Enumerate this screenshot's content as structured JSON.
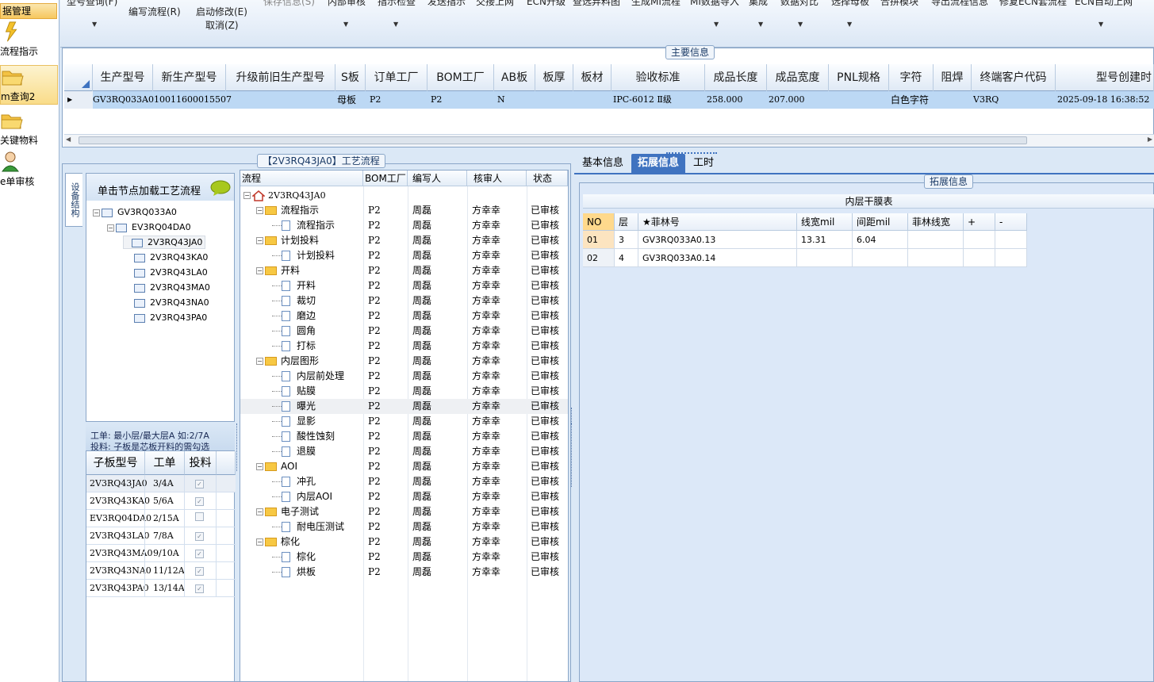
{
  "left_nav": {
    "header": "据管理",
    "items": [
      {
        "label": "流程指示",
        "icon": "lightning-icon"
      },
      {
        "label": "m查询2",
        "icon": "folder-open-icon"
      },
      {
        "label": "关键物料",
        "icon": "folder-open-icon"
      },
      {
        "label": "e单审核",
        "icon": "user-icon"
      }
    ]
  },
  "toolbar": {
    "row1": [
      "型号查询(F)",
      "保存信息(S)",
      "内部审核",
      "指示检查",
      "发送指示",
      "交接上网",
      "ECN升级",
      "查选弃料图",
      "生成MI流程",
      "MI数据导入",
      "集成",
      "数据对比",
      "选择母板",
      "合拼模块",
      "导出流程信息",
      "修复ECN套流程",
      "ECN自动上网"
    ],
    "edit_flow": "编写流程(R)",
    "start_modify": "启动修改(E)",
    "cancel": "取消(Z)"
  },
  "main_info": {
    "title": "主要信息",
    "columns": [
      "生产型号",
      "新生产型号",
      "升级前旧生产型号",
      "S板",
      "订单工厂",
      "BOM工厂",
      "AB板",
      "板厚",
      "板材",
      "验收标准",
      "成品长度",
      "成品宽度",
      "PNL规格",
      "字符",
      "阻焊",
      "终端客户代码",
      "型号创建时"
    ],
    "row": {
      "prod_model": "GV3RQ033A0",
      "new_model": "10011600015507",
      "old_model": "",
      "s_board": "母板",
      "order_factory": "P2",
      "bom_factory": "P2",
      "ab_board": "N",
      "thickness": "",
      "material": "",
      "standard": "IPC-6012 Ⅱ级",
      "length": "258.000",
      "width": "207.000",
      "pnl": "",
      "char": "白色字符",
      "solder": "",
      "customer_code": "V3RQ",
      "created": "2025-09-18 16:38:52"
    }
  },
  "flow_panel_title": "【2V3RQ43JA0】工艺流程",
  "side_tab": "设备结构",
  "tree": {
    "hint": "单击节点加载工艺流程",
    "nodes": [
      "GV3RQ033A0",
      "EV3RQ04DA0",
      "2V3RQ43JA0",
      "2V3RQ43KA0",
      "2V3RQ43LA0",
      "2V3RQ43MA0",
      "2V3RQ43NA0",
      "2V3RQ43PA0"
    ]
  },
  "note": {
    "line1": "工单: 最小层/最大层A 如:2/7A",
    "line2": "投料: 子板是芯板开料的需勾选"
  },
  "sub_grid": {
    "columns": [
      "子板型号",
      "工单",
      "投料"
    ],
    "rows": [
      {
        "model": "2V3RQ43JA0",
        "wo": "3/4A",
        "checked": true
      },
      {
        "model": "2V3RQ43KA0",
        "wo": "5/6A",
        "checked": true
      },
      {
        "model": "EV3RQ04DA0",
        "wo": "2/15A",
        "checked": false
      },
      {
        "model": "2V3RQ43LA0",
        "wo": "7/8A",
        "checked": true
      },
      {
        "model": "2V3RQ43MA0",
        "wo": "9/10A",
        "checked": true
      },
      {
        "model": "2V3RQ43NA0",
        "wo": "11/12A",
        "checked": true
      },
      {
        "model": "2V3RQ43PA0",
        "wo": "13/14A",
        "checked": true
      }
    ]
  },
  "flow": {
    "columns": [
      "流程",
      "BOM工厂",
      "编写人",
      "核审人",
      "状态"
    ],
    "root": "2V3RQ43JA0",
    "rows": [
      {
        "level": 1,
        "name": "流程指示",
        "bom": "P2",
        "writer": "周磊",
        "reviewer": "方幸幸",
        "status": "已审核"
      },
      {
        "level": 2,
        "name": "流程指示",
        "bom": "P2",
        "writer": "周磊",
        "reviewer": "方幸幸",
        "status": "已审核"
      },
      {
        "level": 1,
        "name": "计划投料",
        "bom": "P2",
        "writer": "周磊",
        "reviewer": "方幸幸",
        "status": "已审核"
      },
      {
        "level": 2,
        "name": "计划投料",
        "bom": "P2",
        "writer": "周磊",
        "reviewer": "方幸幸",
        "status": "已审核"
      },
      {
        "level": 1,
        "name": "开料",
        "bom": "P2",
        "writer": "周磊",
        "reviewer": "方幸幸",
        "status": "已审核"
      },
      {
        "level": 2,
        "name": "开料",
        "bom": "P2",
        "writer": "周磊",
        "reviewer": "方幸幸",
        "status": "已审核"
      },
      {
        "level": 2,
        "name": "裁切",
        "bom": "P2",
        "writer": "周磊",
        "reviewer": "方幸幸",
        "status": "已审核"
      },
      {
        "level": 2,
        "name": "磨边",
        "bom": "P2",
        "writer": "周磊",
        "reviewer": "方幸幸",
        "status": "已审核"
      },
      {
        "level": 2,
        "name": "圆角",
        "bom": "P2",
        "writer": "周磊",
        "reviewer": "方幸幸",
        "status": "已审核"
      },
      {
        "level": 2,
        "name": "打标",
        "bom": "P2",
        "writer": "周磊",
        "reviewer": "方幸幸",
        "status": "已审核"
      },
      {
        "level": 1,
        "name": "内层图形",
        "bom": "P2",
        "writer": "周磊",
        "reviewer": "方幸幸",
        "status": "已审核"
      },
      {
        "level": 2,
        "name": "内层前处理",
        "bom": "P2",
        "writer": "周磊",
        "reviewer": "方幸幸",
        "status": "已审核"
      },
      {
        "level": 2,
        "name": "贴膜",
        "bom": "P2",
        "writer": "周磊",
        "reviewer": "方幸幸",
        "status": "已审核"
      },
      {
        "level": 2,
        "name": "曝光",
        "bom": "P2",
        "writer": "周磊",
        "reviewer": "方幸幸",
        "status": "已审核"
      },
      {
        "level": 2,
        "name": "显影",
        "bom": "P2",
        "writer": "周磊",
        "reviewer": "方幸幸",
        "status": "已审核"
      },
      {
        "level": 2,
        "name": "酸性蚀刻",
        "bom": "P2",
        "writer": "周磊",
        "reviewer": "方幸幸",
        "status": "已审核"
      },
      {
        "level": 2,
        "name": "退膜",
        "bom": "P2",
        "writer": "周磊",
        "reviewer": "方幸幸",
        "status": "已审核"
      },
      {
        "level": 1,
        "name": "AOI",
        "bom": "P2",
        "writer": "周磊",
        "reviewer": "方幸幸",
        "status": "已审核"
      },
      {
        "level": 2,
        "name": "冲孔",
        "bom": "P2",
        "writer": "周磊",
        "reviewer": "方幸幸",
        "status": "已审核"
      },
      {
        "level": 2,
        "name": "内层AOI",
        "bom": "P2",
        "writer": "周磊",
        "reviewer": "方幸幸",
        "status": "已审核"
      },
      {
        "level": 1,
        "name": "电子测试",
        "bom": "P2",
        "writer": "周磊",
        "reviewer": "方幸幸",
        "status": "已审核"
      },
      {
        "level": 2,
        "name": "耐电压测试",
        "bom": "P2",
        "writer": "周磊",
        "reviewer": "方幸幸",
        "status": "已审核"
      },
      {
        "level": 1,
        "name": "棕化",
        "bom": "P2",
        "writer": "周磊",
        "reviewer": "方幸幸",
        "status": "已审核"
      },
      {
        "level": 2,
        "name": "棕化",
        "bom": "P2",
        "writer": "周磊",
        "reviewer": "方幸幸",
        "status": "已审核"
      },
      {
        "level": 2,
        "name": "烘板",
        "bom": "P2",
        "writer": "周磊",
        "reviewer": "方幸幸",
        "status": "已审核"
      }
    ]
  },
  "tabs": [
    "基本信息",
    "拓展信息",
    "工时"
  ],
  "ext": {
    "title": "拓展信息",
    "table_title": "内层干膜表",
    "columns": [
      "NO",
      "层",
      "★菲林号",
      "线宽mil",
      "间距mil",
      "菲林线宽",
      "+",
      "-"
    ],
    "rows": [
      [
        "01",
        "3",
        "GV3RQ033A0.13",
        "13.31",
        "6.04",
        "",
        "",
        ""
      ],
      [
        "02",
        "4",
        "GV3RQ033A0.14",
        "",
        "",
        "",
        "",
        ""
      ]
    ]
  }
}
